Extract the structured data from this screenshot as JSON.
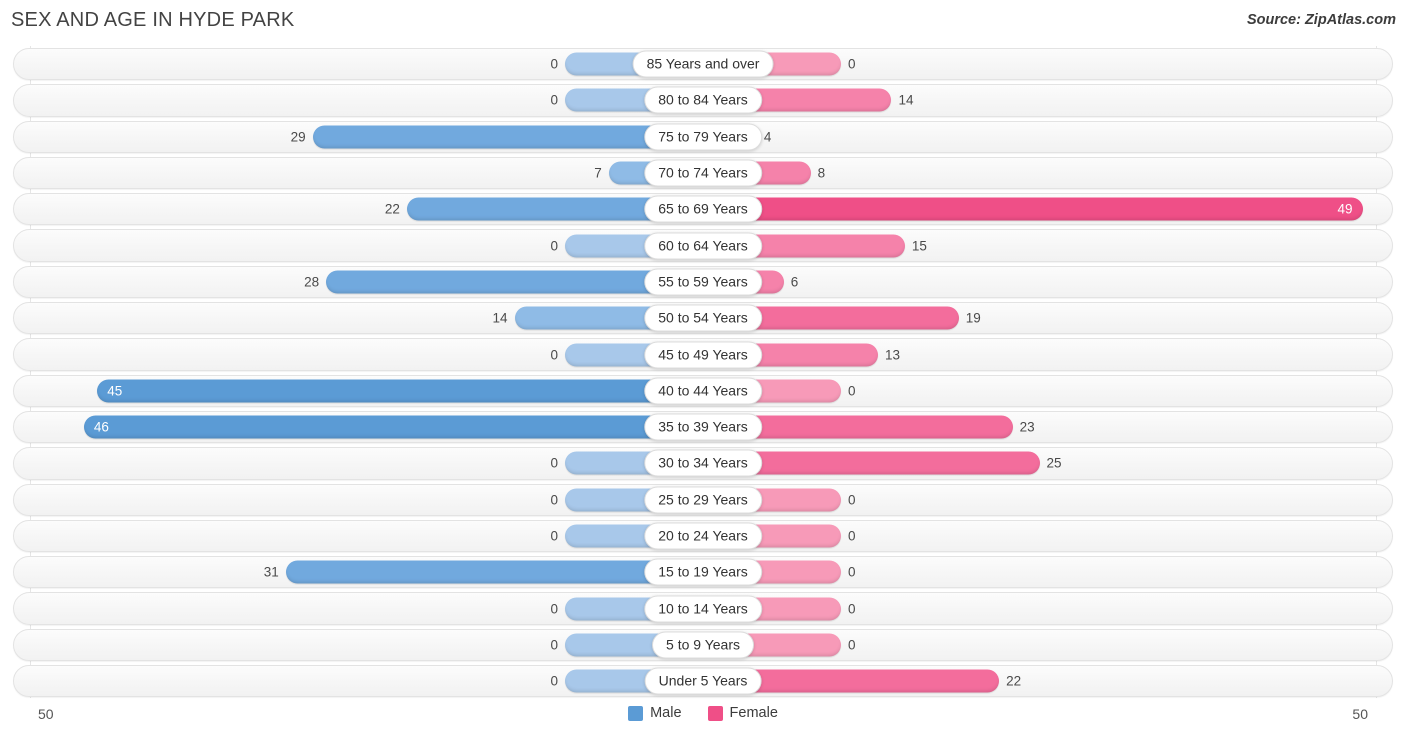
{
  "header": {
    "title": "SEX AND AGE IN HYDE PARK",
    "source": "Source: ZipAtlas.com"
  },
  "legend": {
    "male": {
      "label": "Male",
      "color": "#5b9bd5"
    },
    "female": {
      "label": "Female",
      "color": "#ef4f87"
    }
  },
  "axis": {
    "left_tick": "50",
    "right_tick": "50",
    "max": 50
  },
  "colors": {
    "male_low": "#a8c8ea",
    "male_mid": "#7fb0e0",
    "male_high": "#5b9bd5",
    "female_low": "#f79ab8",
    "female_mid": "#f582aa",
    "female_high": "#ef4f87",
    "track": "#f6f6f6",
    "gridline": "#e6e6e6"
  },
  "chart_data": {
    "type": "bar",
    "subtype": "population-pyramid",
    "title": "SEX AND AGE IN HYDE PARK",
    "xlabel": "",
    "ylabel": "",
    "xlim": [
      50,
      50
    ],
    "grid": true,
    "legend_position": "bottom-center",
    "categories": [
      "85 Years and over",
      "80 to 84 Years",
      "75 to 79 Years",
      "70 to 74 Years",
      "65 to 69 Years",
      "60 to 64 Years",
      "55 to 59 Years",
      "50 to 54 Years",
      "45 to 49 Years",
      "40 to 44 Years",
      "35 to 39 Years",
      "30 to 34 Years",
      "25 to 29 Years",
      "20 to 24 Years",
      "15 to 19 Years",
      "10 to 14 Years",
      "5 to 9 Years",
      "Under 5 Years"
    ],
    "series": [
      {
        "name": "Male",
        "values": [
          0,
          0,
          29,
          7,
          22,
          0,
          28,
          14,
          0,
          45,
          46,
          0,
          0,
          0,
          31,
          0,
          0,
          0
        ]
      },
      {
        "name": "Female",
        "values": [
          0,
          14,
          4,
          8,
          49,
          15,
          6,
          19,
          13,
          0,
          23,
          25,
          0,
          0,
          0,
          0,
          0,
          22
        ]
      }
    ]
  },
  "rows": [
    {
      "label": "85 Years and over",
      "male": "0",
      "female": "0"
    },
    {
      "label": "80 to 84 Years",
      "male": "0",
      "female": "14"
    },
    {
      "label": "75 to 79 Years",
      "male": "29",
      "female": "4"
    },
    {
      "label": "70 to 74 Years",
      "male": "7",
      "female": "8"
    },
    {
      "label": "65 to 69 Years",
      "male": "22",
      "female": "49"
    },
    {
      "label": "60 to 64 Years",
      "male": "0",
      "female": "15"
    },
    {
      "label": "55 to 59 Years",
      "male": "28",
      "female": "6"
    },
    {
      "label": "50 to 54 Years",
      "male": "14",
      "female": "19"
    },
    {
      "label": "45 to 49 Years",
      "male": "0",
      "female": "13"
    },
    {
      "label": "40 to 44 Years",
      "male": "45",
      "female": "0"
    },
    {
      "label": "35 to 39 Years",
      "male": "46",
      "female": "23"
    },
    {
      "label": "30 to 34 Years",
      "male": "0",
      "female": "25"
    },
    {
      "label": "25 to 29 Years",
      "male": "0",
      "female": "0"
    },
    {
      "label": "20 to 24 Years",
      "male": "0",
      "female": "0"
    },
    {
      "label": "15 to 19 Years",
      "male": "31",
      "female": "0"
    },
    {
      "label": "10 to 14 Years",
      "male": "0",
      "female": "0"
    },
    {
      "label": "5 to 9 Years",
      "male": "0",
      "female": "0"
    },
    {
      "label": "Under 5 Years",
      "male": "0",
      "female": "22"
    }
  ]
}
